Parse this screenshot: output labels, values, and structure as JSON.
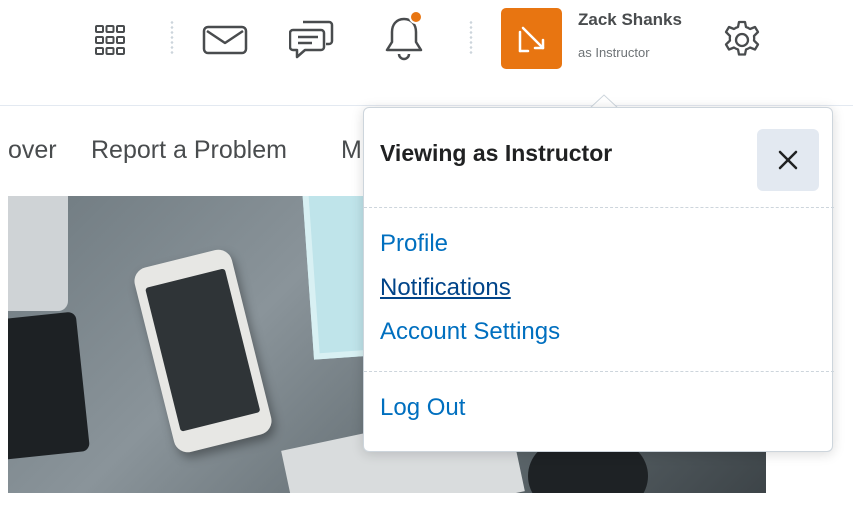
{
  "header": {
    "user_name": "Zack Shanks",
    "user_role": "as Instructor",
    "icons": [
      "waffle-icon",
      "mail-icon",
      "chat-icon",
      "bell-icon",
      "role-switch-icon",
      "gear-icon"
    ],
    "accent_color": "#e87511"
  },
  "nav": {
    "items": [
      {
        "label": "over"
      },
      {
        "label": "Report a Problem"
      },
      {
        "label": "M"
      }
    ]
  },
  "popover": {
    "title": "Viewing as Instructor",
    "close_label": "×",
    "links": [
      {
        "label": "Profile"
      },
      {
        "label": "Notifications"
      },
      {
        "label": "Account Settings"
      }
    ],
    "logout_label": "Log Out",
    "link_color": "#006fbf"
  }
}
